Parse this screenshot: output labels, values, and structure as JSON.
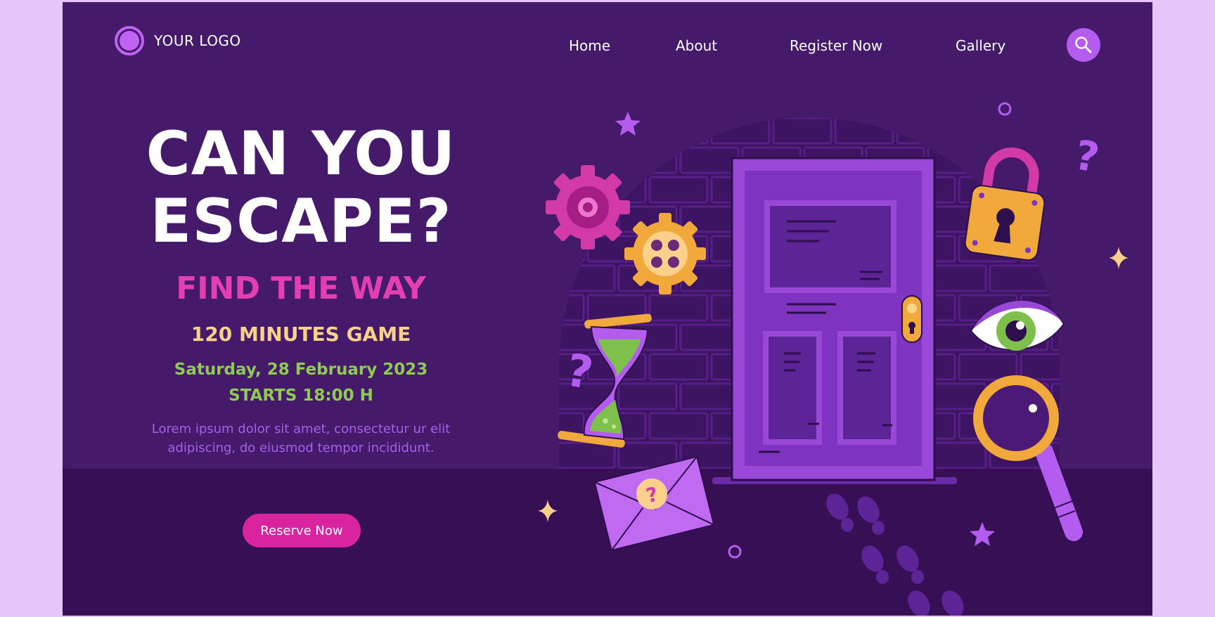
{
  "header": {
    "logo_text": "YOUR LOGO",
    "nav": [
      {
        "label": "Home"
      },
      {
        "label": "About"
      },
      {
        "label": "Register Now"
      },
      {
        "label": "Gallery"
      }
    ],
    "search_icon": "search-icon"
  },
  "hero": {
    "title_line1": "CAN YOU",
    "title_line2": "ESCAPE?",
    "subtitle": "FIND THE WAY",
    "duration": "120 MINUTES GAME",
    "date": "Saturday, 28 February 2023",
    "start_time": "STARTS 18:00 H",
    "description": "Lorem ipsum dolor sit amet, consectetur ur elit adipiscing, do eiusmod tempor incididunt.",
    "cta_label": "Reserve Now"
  },
  "illustration": {
    "icons": [
      "gear-icon",
      "hourglass-icon",
      "door-icon",
      "padlock-icon",
      "eye-icon",
      "magnifier-icon",
      "envelope-icon",
      "question-icon",
      "star-icon",
      "footprints-icon"
    ]
  },
  "colors": {
    "page_bg": "#e7c6fb",
    "panel_bg": "#451a6b",
    "floor": "#370f55",
    "accent_pink": "#d9239f",
    "accent_purple": "#b45cf0",
    "yellow": "#f8d18b",
    "green": "#8fca52"
  }
}
